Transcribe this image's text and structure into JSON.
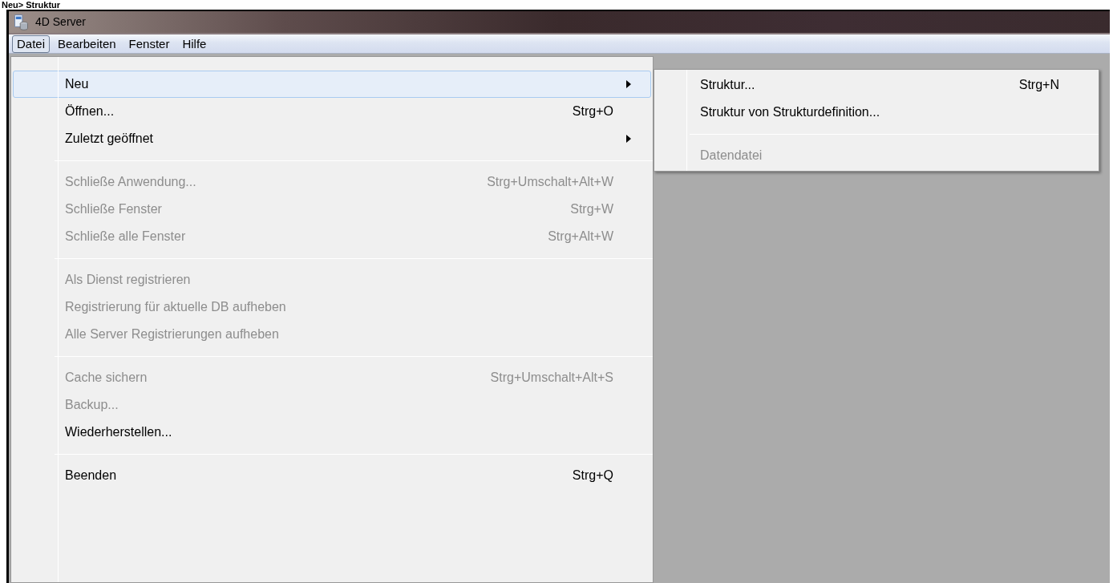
{
  "heading": "Neu> Struktur",
  "window": {
    "title": "4D Server"
  },
  "menubar": [
    {
      "label": "Datei",
      "selected": true
    },
    {
      "label": "Bearbeiten",
      "selected": false
    },
    {
      "label": "Fenster",
      "selected": false
    },
    {
      "label": "Hilfe",
      "selected": false
    }
  ],
  "menu": [
    {
      "kind": "item",
      "label": "Neu",
      "submenu": true,
      "highlighted": true,
      "disabled": false
    },
    {
      "kind": "item",
      "label": "Öffnen...",
      "shortcut": "Strg+O",
      "highlighted": false,
      "disabled": false
    },
    {
      "kind": "item",
      "label": "Zuletzt geöffnet",
      "submenu": true,
      "highlighted": false,
      "disabled": false
    },
    {
      "kind": "separator"
    },
    {
      "kind": "item",
      "label": "Schließe Anwendung...",
      "shortcut": "Strg+Umschalt+Alt+W",
      "highlighted": false,
      "disabled": true
    },
    {
      "kind": "item",
      "label": "Schließe Fenster",
      "shortcut": "Strg+W",
      "highlighted": false,
      "disabled": true
    },
    {
      "kind": "item",
      "label": "Schließe alle Fenster",
      "shortcut": "Strg+Alt+W",
      "highlighted": false,
      "disabled": true
    },
    {
      "kind": "separator"
    },
    {
      "kind": "item",
      "label": "Als Dienst registrieren",
      "highlighted": false,
      "disabled": true
    },
    {
      "kind": "item",
      "label": "Registrierung für aktuelle DB aufheben",
      "highlighted": false,
      "disabled": true
    },
    {
      "kind": "item",
      "label": "Alle Server Registrierungen aufheben",
      "highlighted": false,
      "disabled": true
    },
    {
      "kind": "separator"
    },
    {
      "kind": "item",
      "label": "Cache sichern",
      "shortcut": "Strg+Umschalt+Alt+S",
      "highlighted": false,
      "disabled": true
    },
    {
      "kind": "item",
      "label": "Backup...",
      "highlighted": false,
      "disabled": true
    },
    {
      "kind": "item",
      "label": "Wiederherstellen...",
      "highlighted": false,
      "disabled": false
    },
    {
      "kind": "separator"
    },
    {
      "kind": "item",
      "label": "Beenden",
      "shortcut": "Strg+Q",
      "highlighted": false,
      "disabled": false
    }
  ],
  "submenu": [
    {
      "kind": "item",
      "label": "Struktur...",
      "shortcut": "Strg+N",
      "disabled": false
    },
    {
      "kind": "item",
      "label": "Struktur von Strukturdefinition...",
      "disabled": false
    },
    {
      "kind": "separator"
    },
    {
      "kind": "item",
      "label": "Datendatei",
      "disabled": true
    }
  ]
}
